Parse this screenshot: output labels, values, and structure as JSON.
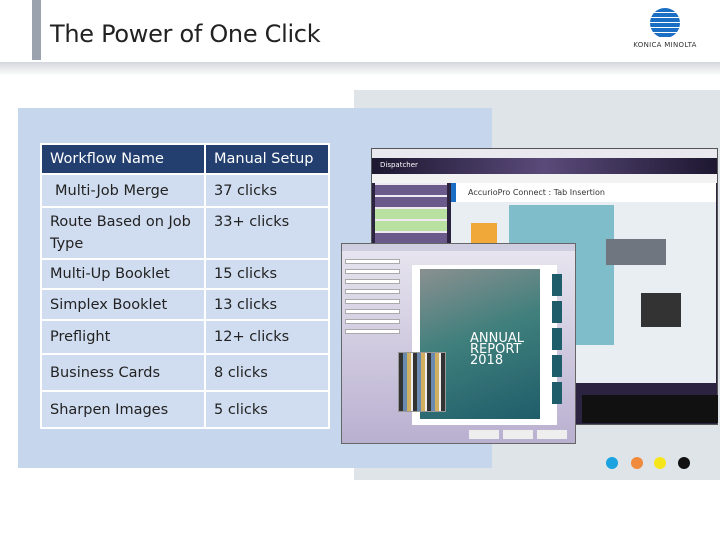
{
  "header": {
    "title": "The Power of One Click",
    "logo_text": "KONICA MINOLTA"
  },
  "table": {
    "columns": [
      "Workflow Name",
      "Manual Setup"
    ],
    "rows": [
      [
        "Multi-Job Merge",
        "37 clicks"
      ],
      [
        "Route Based on Job Type",
        "33+ clicks"
      ],
      [
        "Multi-Up Booklet",
        "15 clicks"
      ],
      [
        "Simplex Booklet",
        "13 clicks"
      ],
      [
        "Preflight",
        "12+ clicks"
      ],
      [
        "Business Cards",
        "8 clicks"
      ],
      [
        "Sharpen Images",
        "5 clicks"
      ]
    ]
  },
  "screenshot": {
    "app_name": "Dispatcher",
    "workflow_title": "AccurioPro Connect : Tab Insertion",
    "cover_text": "ANNUAL REPORT 2018"
  },
  "colors": {
    "cyan": "#1aa3e0",
    "orange": "#f08a3c",
    "yellow": "#f5e51a",
    "black": "#111111",
    "header": "#223f6f",
    "accent": "#1a6fc4"
  }
}
